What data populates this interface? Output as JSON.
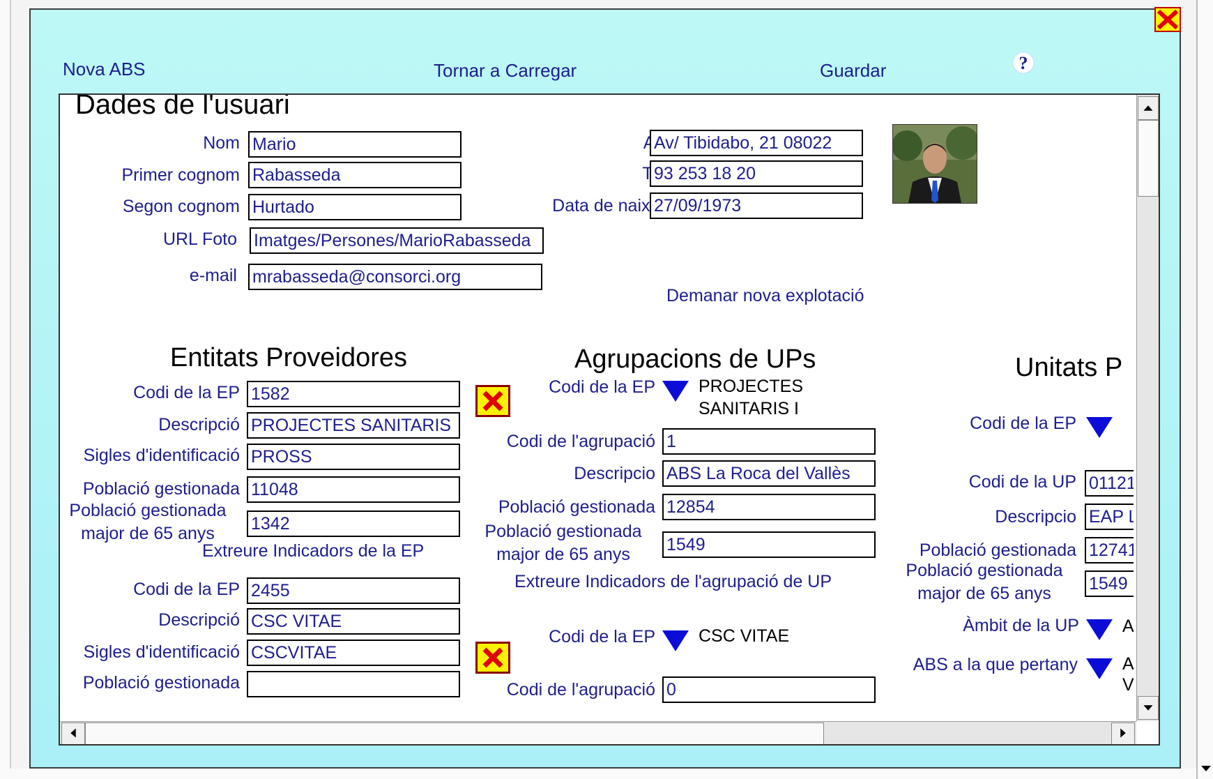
{
  "toolbar": {
    "new_abs": "Nova ABS",
    "reload": "Tornar a Carregar",
    "save": "Guardar",
    "help_icon": "?"
  },
  "user": {
    "title": "Dades de l'usuari",
    "nom_label": "Nom",
    "nom": "Mario",
    "primer_label": "Primer cognom",
    "primer": "Rabasseda",
    "segon_label": "Segon cognom",
    "segon": "Hurtado",
    "url_label": "URL Foto",
    "url": "Imatges/Persones/MarioRabasseda",
    "email_label": "e-mail",
    "email": "mrabasseda@consorci.org",
    "adreca_label": "Adreça",
    "adreca": "Av/ Tibidabo, 21 08022",
    "telefon_label": "Telèfon",
    "telefon": "93 253 18 20",
    "naix_label": "Data de naixement",
    "naix": "27/09/1973",
    "request_link": "Demanar nova explotació"
  },
  "ep": {
    "title": "Entitats Proveidores",
    "codi_label": "Codi de la EP",
    "desc_label": "Descripció",
    "sigles_label": "Sigles d'identificació",
    "pob_label": "Població gestionada",
    "pob65_label_1": "Població gestionada",
    "pob65_label_2": "major de 65 anys",
    "extract_link": "Extreure Indicadors de la EP",
    "items": [
      {
        "codi": "1582",
        "desc": "PROJECTES SANITARIS I",
        "sigles": "PROSS",
        "pob": "11048",
        "pob65": "1342"
      },
      {
        "codi": "2455",
        "desc": "CSC VITAE",
        "sigles": "CSCVITAE",
        "pob": ""
      }
    ]
  },
  "agr": {
    "title": "Agrupacions de UPs",
    "codi_ep_label": "Codi de la EP",
    "codi_agr_label": "Codi de l'agrupació",
    "desc_label": "Descripcio",
    "pob_label": "Població gestionada",
    "pob65_label_1": "Població gestionada",
    "pob65_label_2": "major de 65 anys",
    "extract_link": "Extreure Indicadors de l'agrupació de UP",
    "items": [
      {
        "ep_line1": "PROJECTES",
        "ep_line2": "SANITARIS I",
        "codi": "1",
        "desc": "ABS La Roca del Vallès",
        "pob": "12854",
        "pob65": "1549"
      },
      {
        "ep_line1": "CSC VITAE",
        "codi": "0"
      }
    ]
  },
  "up": {
    "title": "Unitats P",
    "codi_ep_label": "Codi de la EP",
    "codi_up_label": "Codi de la UP",
    "codi_up": "01121",
    "desc_label": "Descripcio",
    "desc": "EAP L",
    "pob_label": "Població gestionada",
    "pob": "12741",
    "pob65_label_1": "Població gestionada",
    "pob65_label_2": "major de 65 anys",
    "pob65": "1549",
    "ambit_label": "Àmbit de la UP",
    "ambit": "A",
    "abs_label": "ABS a la que pertany",
    "abs_line1": "A",
    "abs_line2": "V"
  },
  "colors": {
    "window_bg": "#bdf8f6",
    "label": "#1e1e8c",
    "dropdown": "#0c0cd8",
    "delete_bg": "#fff200"
  }
}
